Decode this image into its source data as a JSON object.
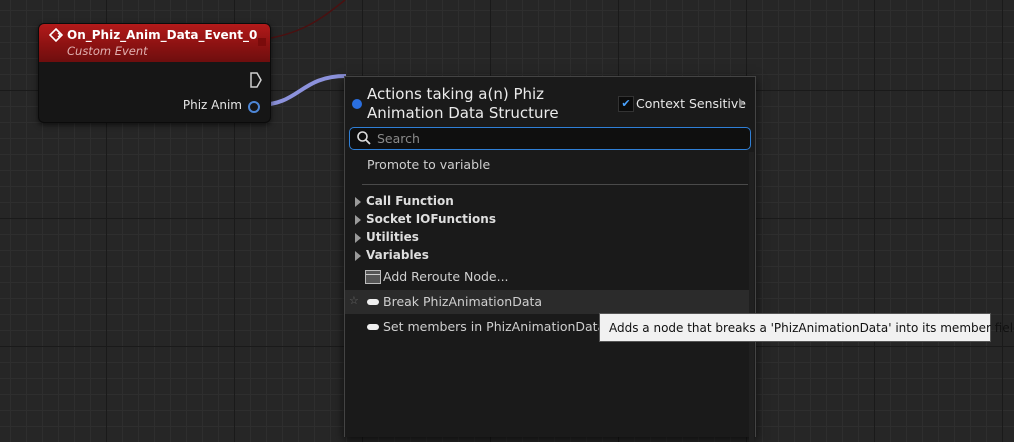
{
  "event_node": {
    "title": "On_Phiz_Anim_Data_Event_0",
    "subtitle": "Custom Event",
    "pin_label": "Phiz Anim"
  },
  "menu": {
    "title": "Actions taking a(n) Phiz Animation Data Structure",
    "context_sensitive_label": "Context Sensitive",
    "context_sensitive_checked": true,
    "search_placeholder": "Search",
    "promote_label": "Promote to variable",
    "categories": [
      "Call Function",
      "Socket IOFunctions",
      "Utilities",
      "Variables"
    ],
    "reroute_label": "Add Reroute Node...",
    "actions": [
      {
        "label": "Break PhizAnimationData",
        "highlighted": true
      },
      {
        "label": "Set members in PhizAnimationData",
        "highlighted": false
      }
    ]
  },
  "tooltip": {
    "text": "Adds a node that breaks a 'PhizAnimationData' into its member fields"
  },
  "colors": {
    "event_header": "#b31a1a",
    "struct_wire": "#8c92dc",
    "accent_blue": "#2f7fd6"
  }
}
